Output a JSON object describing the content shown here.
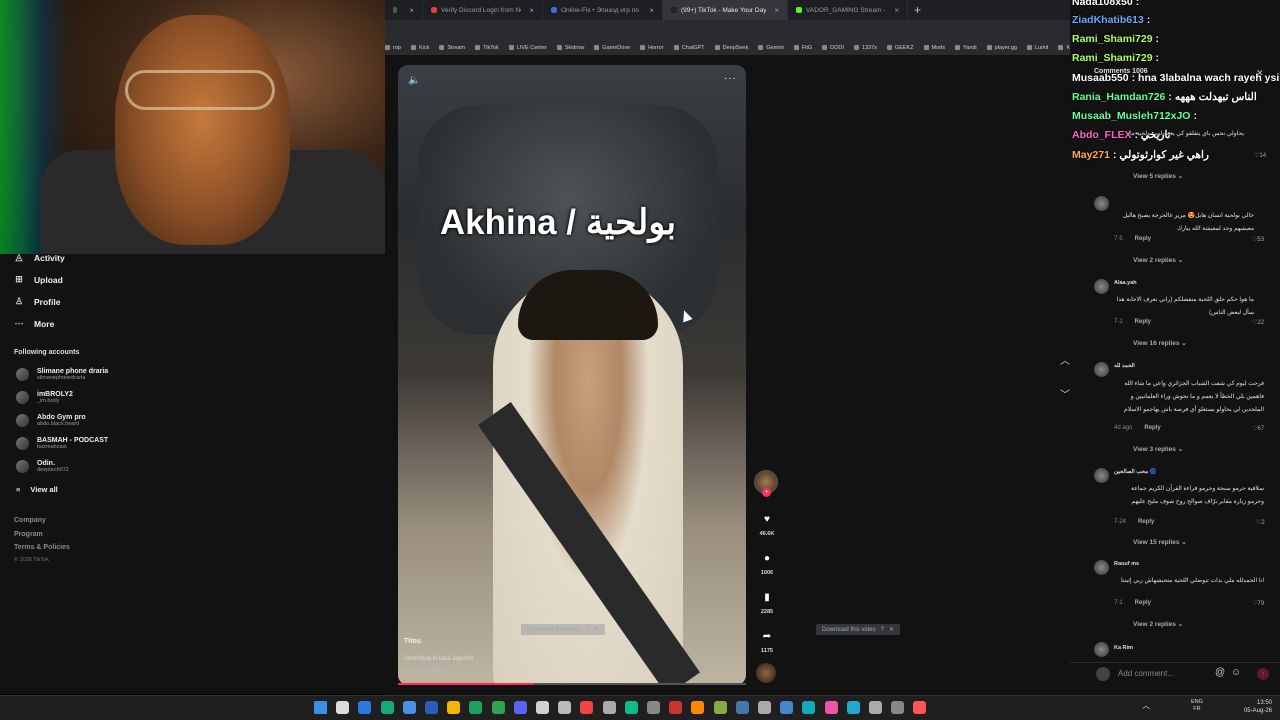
{
  "browser": {
    "tabs": [
      {
        "label": "2639)",
        "color": "#555",
        "active": false
      },
      {
        "label": "Verify Discord Login from New Lo",
        "color": "#e03c3c",
        "active": false
      },
      {
        "label": "Online-Fix • Эпизод игр по сети",
        "color": "#3a6ad4",
        "active": false
      },
      {
        "label": "(99+) TikTok - Make Your Day",
        "color": "#222",
        "active": true
      },
      {
        "label": "VADOR_GAMING Stream - W",
        "color": "#53fc18",
        "active": false
      }
    ],
    "new_tab": "+",
    "bookmarks": [
      "rop",
      "Kick",
      "Stream",
      "TikTok",
      "LIVE Center",
      "Skidrow",
      "GameDrive",
      "Horror",
      "ChatGPT",
      "DeepSeek",
      "Gemini",
      "FitG",
      "DODI",
      "1337x",
      "GEEKZ",
      "Mods",
      "Yandi",
      "player.gg",
      "Lurkit",
      "Keymailer",
      "creators.gg"
    ]
  },
  "sidebar": {
    "nav": [
      {
        "label": "Activity",
        "icon": "bell-icon"
      },
      {
        "label": "Upload",
        "icon": "plus-square-icon"
      },
      {
        "label": "Profile",
        "icon": "person-icon"
      },
      {
        "label": "More",
        "icon": "ellipsis-icon"
      }
    ],
    "following_title": "Following accounts",
    "accounts": [
      {
        "name": "Slimane phone draria",
        "user": "slimanephonedraria"
      },
      {
        "name": "imBROLY2",
        "user": "_im.broly"
      },
      {
        "name": "Abdo Gym pro",
        "user": "abdo.black.beard"
      },
      {
        "name": "BASMAH - PODCAST",
        "user": "basmahcast"
      },
      {
        "name": "Odin.",
        "user": "deeptech072"
      }
    ],
    "view_all": "View all",
    "footer": [
      "Company",
      "Program",
      "Terms & Policies"
    ],
    "copyright": "© 2026 TikTok"
  },
  "video": {
    "title": "Akhina / بولحية",
    "creator": "Titou",
    "caption": "Semholna ki rana 3aychin",
    "see_translation": "See translation",
    "progress": 0.39,
    "download_label": "Download this video",
    "likes": "46.6K",
    "comments": "1006",
    "saves": "2285",
    "shares": "1175"
  },
  "chat_overlay": [
    {
      "user": "Nada108x50",
      "msg": ":",
      "color": "#ffffff"
    },
    {
      "user": "ZiadKhatib613",
      "msg": ":",
      "color": "#6fa8ff"
    },
    {
      "user": "Rami_Shami729",
      "msg": ":",
      "color": "#aaff66"
    },
    {
      "user": "Rami_Shami729",
      "msg": ":",
      "color": "#aaff66"
    },
    {
      "user": "Musaab550",
      "msg": ": hna 3labalna wach rayeh ysir",
      "color": "#ffffff"
    },
    {
      "user": "Rania_Hamdan726",
      "msg": ": الناس تبهدلت هههه",
      "color": "#66ff99"
    },
    {
      "user": "Musaab_Musleh712xJO",
      "msg": ":",
      "color": "#66ff99"
    },
    {
      "user": "Abdo_FLEX",
      "msg": ": تاريخي",
      "color": "#ff66cc"
    },
    {
      "user": "May271",
      "msg": ": راهي غير كوارثوتولي",
      "color": "#ffaa44"
    }
  ],
  "comments_panel": {
    "header": "Comments 1006",
    "first_snippet": "يحاولي نحس باي يتقلقو كي يعطولهم بولحية ما",
    "first_likes": "14",
    "comments": [
      {
        "user": "",
        "text": "خالي بولحية انسان هايل😍 مزير غالحرجة يصبح هاليل معيشهم وجد لمعيشة الله يبارك",
        "date": "7-5",
        "likes": "53",
        "view_replies": "View 2 replies"
      },
      {
        "user": "Alaa.yah",
        "text": "ما هوا حكم حلق اللحية متفضلكم (راني نعرف الاجابة هذا سأل لبعض الناس)",
        "date": "7-1",
        "likes": "22",
        "view_replies": "View 16 replies"
      },
      {
        "user": "الحمد لله",
        "text": "فرحت ليوم كي شفت الشباب الجزائري واعي ما شاء الله فاهمين بلي الخطأ لا يعمم و ما نحوش وراء العلمانيين و الملحدين لي يحاولو يستغلو أي فرصة باش يهاجمو الاسلام",
        "date": "4d ago",
        "likes": "67",
        "view_replies": "View 3 replies"
      },
      {
        "user": "محب الصالحين 🌀",
        "text": "سلافية حرمو سبحة وحرمو قراءة القرآن الكريم جماعة وحرمو زيارة مقابر برّاف صوالح روح شوف مليح عليهم",
        "date": "7-24",
        "likes": "2",
        "view_replies": "View 15 replies"
      },
      {
        "user": "Raouf ms",
        "text": "انا الحمدلله ملي بدات تنوضلي اللحية متحبشهاش ربي إثبتنا",
        "date": "7-1",
        "likes": "79",
        "view_replies": "View 2 replies"
      },
      {
        "user": "Ka Rim",
        "text": "",
        "date": "",
        "likes": "",
        "view_replies": ""
      }
    ],
    "view_5_replies": "View 5 replies",
    "reply_label": "Reply",
    "add_comment_placeholder": "Add comment..."
  },
  "taskbar": {
    "lang": "ENG",
    "lang2": "FR",
    "time": "13:50",
    "date": "05-Aug-26"
  },
  "colors": {
    "accent": "#fe2c55",
    "bg": "#121212"
  }
}
